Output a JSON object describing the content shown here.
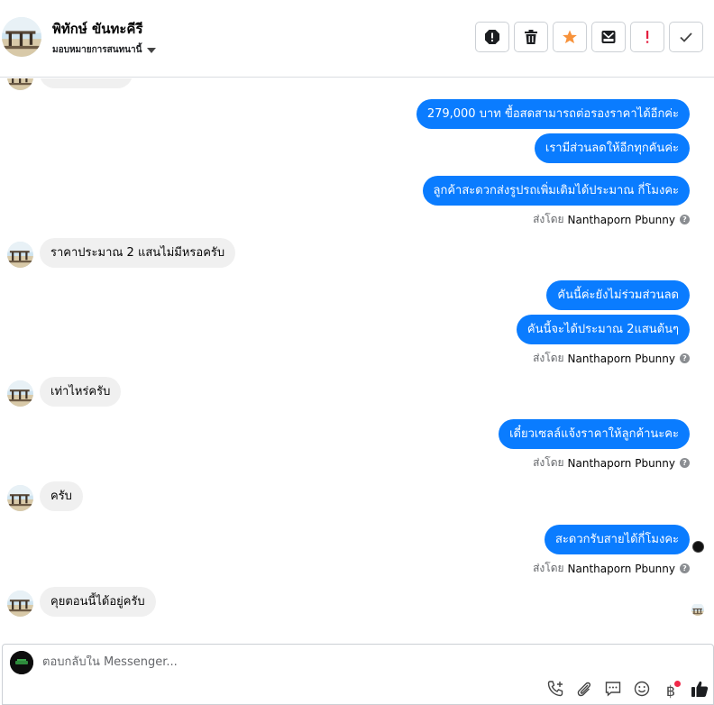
{
  "header": {
    "contact_name": "พิทักษ์ ขันทะคีรี",
    "assign_label": "มอบหมายการสนทนานี้"
  },
  "toolbar": {
    "icons": [
      "spam-icon",
      "trash-icon",
      "star-icon",
      "archive-icon",
      "important-icon",
      "done-icon"
    ],
    "star_color": "#f7923b",
    "important_color": "#e41e3f"
  },
  "messages": {
    "m1": "279,000 บาท ขื้อสดสามารถต่อรองราคาได้อีกค่ะ",
    "m2": "เรามีส่วนลดให้อีกทุกคันค่ะ",
    "m3": "ลูกค้าสะดวกส่งรูปรถเพิ่มเติมได้ประมาณ กี่โมงคะ",
    "m4": "ราคาประมาณ 2 แสนไม่มีหรอครับ",
    "m5": "คันนี้ค่ะยังไม่ร่วมส่วนลด",
    "m6": "คันนี้จะได้ประมาณ 2แสนต้นๆ",
    "m7": "เท่าไหร่ครับ",
    "m8": "เดี๋ยวเซลล์แจ้งราคาให้ลูกค้านะคะ",
    "m9": "ครับ",
    "m10": "สะดวกรับสายได้กี่โมงคะ",
    "m11": "คุยตอนนี้ได้อยู่ครับ"
  },
  "sent_by": {
    "prefix": "ส่งโดย",
    "name": "Nanthaporn Pbunny",
    "help": "?"
  },
  "composer": {
    "placeholder": "ตอบกลับใน Messenger...",
    "icons": [
      "call-add-icon",
      "attachment-icon",
      "saved-reply-icon",
      "emoji-icon",
      "payment-icon",
      "like-icon"
    ],
    "payment_symbol": "฿"
  },
  "colors": {
    "outgoing_bubble": "#0a7cff",
    "incoming_bubble": "#f0f0f0"
  }
}
